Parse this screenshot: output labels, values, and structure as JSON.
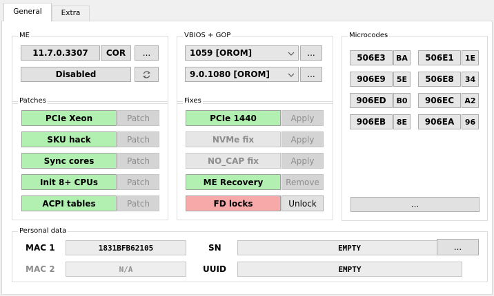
{
  "tabs": [
    {
      "label": "General"
    },
    {
      "label": "Extra"
    }
  ],
  "me": {
    "title": "ME",
    "version": "11.7.0.3307",
    "sku": "COR",
    "more": "...",
    "state": "Disabled"
  },
  "vbios": {
    "title": "VBIOS + GOP",
    "vbios_value": "1059 [OROM]",
    "gop_value": "9.0.1080 [OROM]",
    "more": "..."
  },
  "microcodes": {
    "title": "Microcodes",
    "items": [
      {
        "cpuid": "506E3",
        "platform": "BA"
      },
      {
        "cpuid": "506E1",
        "platform": "1E"
      },
      {
        "cpuid": "906E9",
        "platform": "5E"
      },
      {
        "cpuid": "506E8",
        "platform": "34"
      },
      {
        "cpuid": "906ED",
        "platform": "B0"
      },
      {
        "cpuid": "906EC",
        "platform": "A2"
      },
      {
        "cpuid": "906EB",
        "platform": "8E"
      },
      {
        "cpuid": "906EA",
        "platform": "96"
      }
    ],
    "more": "..."
  },
  "patches": {
    "title": "Patches",
    "items": [
      {
        "label": "PCIe Xeon",
        "action": "Patch"
      },
      {
        "label": "SKU hack",
        "action": "Patch"
      },
      {
        "label": "Sync cores",
        "action": "Patch"
      },
      {
        "label": "Init 8+ CPUs",
        "action": "Patch"
      },
      {
        "label": "ACPI tables",
        "action": "Patch"
      }
    ]
  },
  "fixes": {
    "title": "Fixes",
    "items": [
      {
        "label": "PCIe 1440",
        "action": "Apply"
      },
      {
        "label": "NVMe fix",
        "action": "Apply"
      },
      {
        "label": "NO_CAP fix",
        "action": "Apply"
      },
      {
        "label": "ME Recovery",
        "action": "Remove"
      },
      {
        "label": "FD locks",
        "action": "Unlock"
      }
    ]
  },
  "personal": {
    "title": "Personal data",
    "mac1_label": "MAC 1",
    "mac1_value": "1831BFB62105",
    "mac2_label": "MAC 2",
    "mac2_value": "N/A",
    "sn_label": "SN",
    "sn_value": "EMPTY",
    "uuid_label": "UUID",
    "uuid_value": "EMPTY",
    "more": "..."
  },
  "colors": {
    "enabled": "#b1f0b1",
    "locked": "#f7a9a9",
    "window": "#f0f0f0"
  }
}
